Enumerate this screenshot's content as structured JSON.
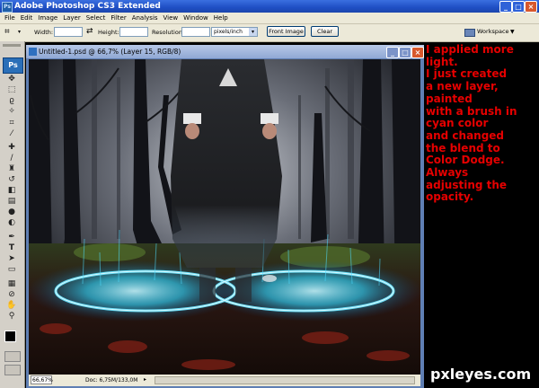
{
  "app": {
    "title": "Adobe Photoshop CS3 Extended",
    "logo": "Ps",
    "window_controls": {
      "minimize": "_",
      "maximize": "□",
      "close": "×"
    }
  },
  "menu": [
    "File",
    "Edit",
    "Image",
    "Layer",
    "Select",
    "Filter",
    "Analysis",
    "View",
    "Window",
    "Help"
  ],
  "options_bar": {
    "width_label": "Width:",
    "width_value": "",
    "height_label": "Height:",
    "height_value": "",
    "resolution_label": "Resolution:",
    "resolution_value": "",
    "resolution_unit": "pixels/inch",
    "front_image_label": "Front Image",
    "clear_label": "Clear",
    "workspace_label": "Workspace"
  },
  "document": {
    "title": "Untitled-1.psd @ 66,7% (Layer 15, RGB/8)",
    "zoom": "66,67%",
    "doc_info": "Doc: 6,75M/133,0M"
  },
  "annotation": {
    "lines": [
      "I applied more",
      "light.",
      "I just created",
      "a new layer,",
      "painted",
      "with a brush in",
      "cyan color",
      "and changed",
      "the blend to",
      "Color Dodge.",
      "Always",
      "adjusting the",
      "opacity."
    ],
    "color": "#e60000"
  },
  "watermark": "pxleyes.com",
  "colors": {
    "xp_blue": "#1f4fc4",
    "chrome": "#ece9d8",
    "glow": "#2fd6ff"
  },
  "icons": [
    "crop-icon",
    "move-icon",
    "marquee-icon",
    "lasso-icon",
    "magic-wand-icon",
    "eyedropper-icon",
    "brush-icon",
    "stamp-icon",
    "eraser-icon",
    "gradient-icon",
    "blur-icon",
    "dodge-icon",
    "pen-icon",
    "type-icon",
    "path-select-icon",
    "shape-icon",
    "notes-icon",
    "hand-icon",
    "zoom-icon"
  ]
}
